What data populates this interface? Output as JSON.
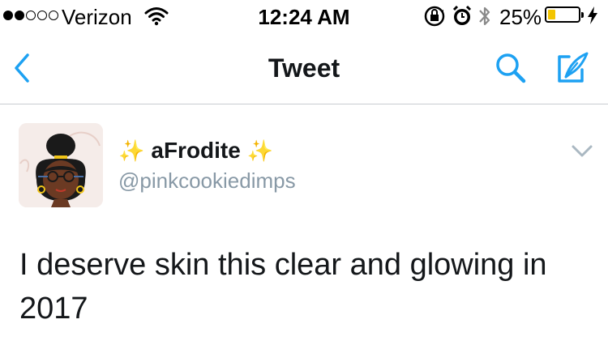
{
  "status_bar": {
    "carrier": "Verizon",
    "time": "12:24 AM",
    "battery_percent": "25%",
    "battery_level": 0.25,
    "signal_bars_filled": 2,
    "signal_bars_total": 5,
    "icons": [
      "signal-icon",
      "wifi-icon",
      "rotation-lock-icon",
      "alarm-icon",
      "bluetooth-icon",
      "battery-icon",
      "charging-bolt-icon"
    ]
  },
  "nav": {
    "title": "Tweet",
    "icons": [
      "back-chevron-icon",
      "search-icon",
      "compose-icon"
    ],
    "accent_color": "#1da1f2"
  },
  "tweet": {
    "display_name": "aFrodite",
    "name_emoji": "✨",
    "handle": "@pinkcookiedimps",
    "text": "I deserve skin this clear and glowing in 2017",
    "menu_icon": "chevron-down-icon"
  }
}
